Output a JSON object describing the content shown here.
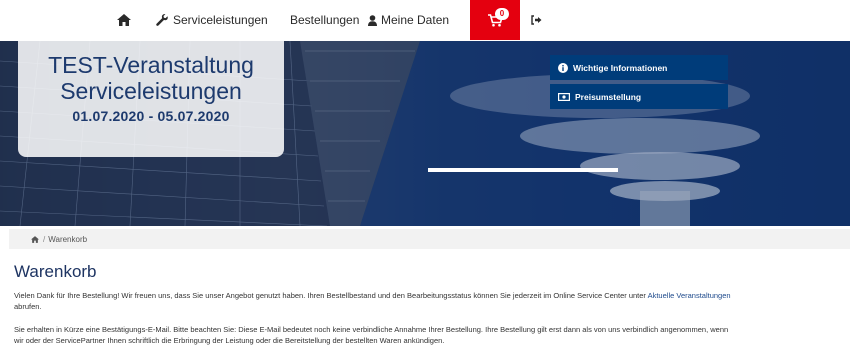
{
  "nav": {
    "services_label": "Serviceleistungen",
    "orders_label": "Bestellungen",
    "mydata_label": "Meine Daten",
    "cart_count": "0",
    "icons": [
      "home-icon",
      "wrench-icon",
      "user-icon",
      "cart-icon",
      "logout-icon"
    ]
  },
  "hero": {
    "title_line1": "TEST-Veranstaltung",
    "title_line2": "Serviceleistungen",
    "dates": "01.07.2020 - 05.07.2020",
    "buttons": [
      {
        "label": "Wichtige Informationen",
        "icon": "info-icon"
      },
      {
        "label": "Preisumstellung",
        "icon": "money-icon"
      }
    ]
  },
  "breadcrumb": {
    "current": "Warenkorb"
  },
  "main": {
    "title": "Warenkorb",
    "para1_text": "Vielen Dank für Ihre Bestellung! Wir freuen uns, dass Sie unser Angebot genutzt haben. Ihren Bestellbestand und den Bearbeitungsstatus können Sie jederzeit im Online Service Center unter ",
    "para1_link": "Aktuelle Veranstaltungen",
    "para1_end": " abrufen.",
    "para2": "Sie erhalten in Kürze eine Bestätigungs-E-Mail. Bitte beachten Sie: Diese E-Mail bedeutet noch keine verbindliche Annahme Ihrer Bestellung. Ihre Bestellung gilt erst dann als von uns verbindlich angenommen, wenn wir oder der ServicePartner Ihnen schriftlich die Erbringung der Leistung oder die Bereitstellung der bestellten Waren ankündigen."
  },
  "colors": {
    "brand": "#1e3462",
    "cart": "#e4000f",
    "button": "#003c7a"
  }
}
